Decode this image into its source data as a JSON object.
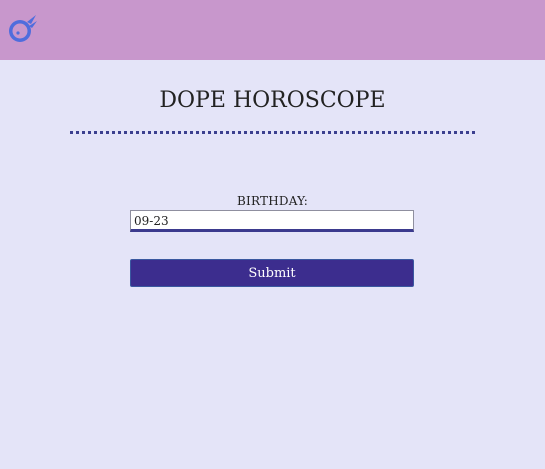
{
  "header": {
    "logo_icon": "comet-icon",
    "background_color": "#c897cc",
    "logo_color": "#4f6ddd"
  },
  "main": {
    "title": "DOPE HOROSCOPE",
    "birthday_label": "BIRTHDAY:",
    "birthday_value": "09-23",
    "submit_label": "Submit",
    "accent_color": "#3c2d8e"
  }
}
